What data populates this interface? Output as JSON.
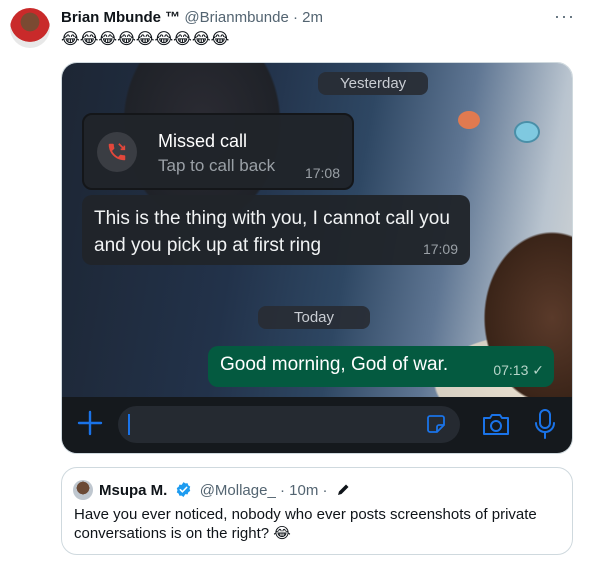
{
  "tweet": {
    "author_name": "Brian Mbunde",
    "author_badge": "™",
    "handle": "@Brianmbunde",
    "separator": "·",
    "time": "2m",
    "more_label": "···",
    "text": "😂😂😂😂😂😂😂😂😂"
  },
  "chat": {
    "date_yesterday": "Yesterday",
    "date_today": "Today",
    "missed_call": {
      "title": "Missed call",
      "subtitle": "Tap to call back",
      "time": "17:08"
    },
    "incoming_message": {
      "text": "This is the thing with you, I cannot call you and you pick up at first ring",
      "time": "17:09"
    },
    "outgoing_message": {
      "text": "Good morning, God of war.",
      "time": "07:13 ✓"
    },
    "colors": {
      "outgoing_bubble": "#045a40",
      "incoming_bubble": "#20242a",
      "accent_blue": "#1a73e8",
      "missed_red": "#e2473b"
    },
    "icons": [
      "plus-icon",
      "sticker-icon",
      "camera-icon",
      "microphone-icon",
      "missed-call-icon"
    ]
  },
  "quote": {
    "author_name": "Msupa M.",
    "handle": "@Mollage_",
    "separator": "·",
    "time": "10m",
    "separator2": "·",
    "text": "Have you ever noticed, nobody who ever posts screenshots of private conversations is on the right? 😂"
  }
}
